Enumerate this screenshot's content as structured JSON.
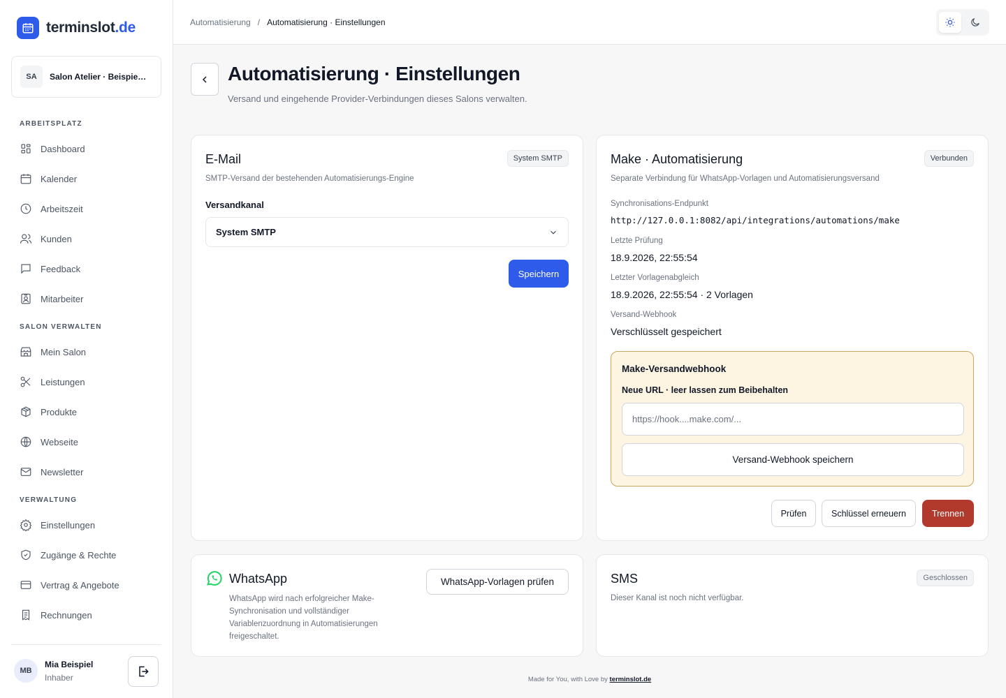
{
  "brand": {
    "name": "terminslot",
    "tld": ".de"
  },
  "salon_switcher": {
    "initials": "SA",
    "name": "Salon Atelier · Beispiel…"
  },
  "sidebar": {
    "sections": [
      {
        "heading": "ARBEITSPLATZ",
        "items": [
          "Dashboard",
          "Kalender",
          "Arbeitszeit",
          "Kunden",
          "Feedback",
          "Mitarbeiter"
        ]
      },
      {
        "heading": "SALON VERWALTEN",
        "items": [
          "Mein Salon",
          "Leistungen",
          "Produkte",
          "Webseite",
          "Newsletter"
        ]
      },
      {
        "heading": "VERWALTUNG",
        "items": [
          "Einstellungen",
          "Zugänge & Rechte",
          "Vertrag & Angebote",
          "Rechnungen"
        ]
      }
    ],
    "icons": [
      "grid-icon",
      "calendar-icon",
      "clock-icon",
      "users-icon",
      "message-icon",
      "badge-icon",
      "store-icon",
      "scissors-icon",
      "box-icon",
      "globe-icon",
      "mail-icon",
      "gear-icon",
      "shield-icon",
      "credit-card-icon",
      "receipt-icon"
    ]
  },
  "user": {
    "initials": "MB",
    "name": "Mia Beispiel",
    "role": "Inhaber"
  },
  "breadcrumb": {
    "parent": "Automatisierung",
    "separator": "/",
    "current": "Automatisierung · Einstellungen"
  },
  "page": {
    "title": "Automatisierung · Einstellungen",
    "subtitle": "Versand und eingehende Provider-Verbindungen dieses Salons verwalten."
  },
  "email_card": {
    "title": "E-Mail",
    "badge": "System SMTP",
    "description": "SMTP-Versand der bestehenden Automatisierungs-Engine",
    "field_label": "Versandkanal",
    "selected": "System SMTP",
    "save_label": "Speichern"
  },
  "make_card": {
    "title": "Make · Automatisierung",
    "badge": "Verbunden",
    "description": "Separate Verbindung für WhatsApp-Vorlagen und Automatisierungsversand",
    "endpoint_label": "Synchronisations-Endpunkt",
    "endpoint_value": "http://127.0.0.1:8082/api/integrations/automations/make",
    "last_check_label": "Letzte Prüfung",
    "last_check_value": "18.9.2026, 22:55:54",
    "last_sync_label": "Letzter Vorlagenabgleich",
    "last_sync_value": "18.9.2026, 22:55:54 · 2 Vorlagen",
    "webhook_label": "Versand-Webhook",
    "webhook_value": "Verschlüsselt gespeichert",
    "webhook_box": {
      "title": "Make-Versandwebhook",
      "field_label": "Neue URL · leer lassen zum Beibehalten",
      "placeholder": "https://hook....make.com/...",
      "save_label": "Versand-Webhook speichern"
    },
    "actions": {
      "check": "Prüfen",
      "renew": "Schlüssel erneuern",
      "disconnect": "Trennen"
    }
  },
  "whatsapp_card": {
    "title": "WhatsApp",
    "description": "WhatsApp wird nach erfolgreicher Make-Synchronisation und vollständiger Variablenzuordnung in Automatisierungen freigeschaltet.",
    "button": "WhatsApp-Vorlagen prüfen"
  },
  "sms_card": {
    "title": "SMS",
    "badge": "Geschlossen",
    "description": "Dieser Kanal ist noch nicht verfügbar."
  },
  "footer": {
    "text": "Made for You, with Love by",
    "link": "terminslot.de"
  },
  "colors": {
    "accent": "#2f5bea",
    "danger": "#b23a2c",
    "warning_bg": "#fdf4e1",
    "whatsapp": "#25d366"
  }
}
